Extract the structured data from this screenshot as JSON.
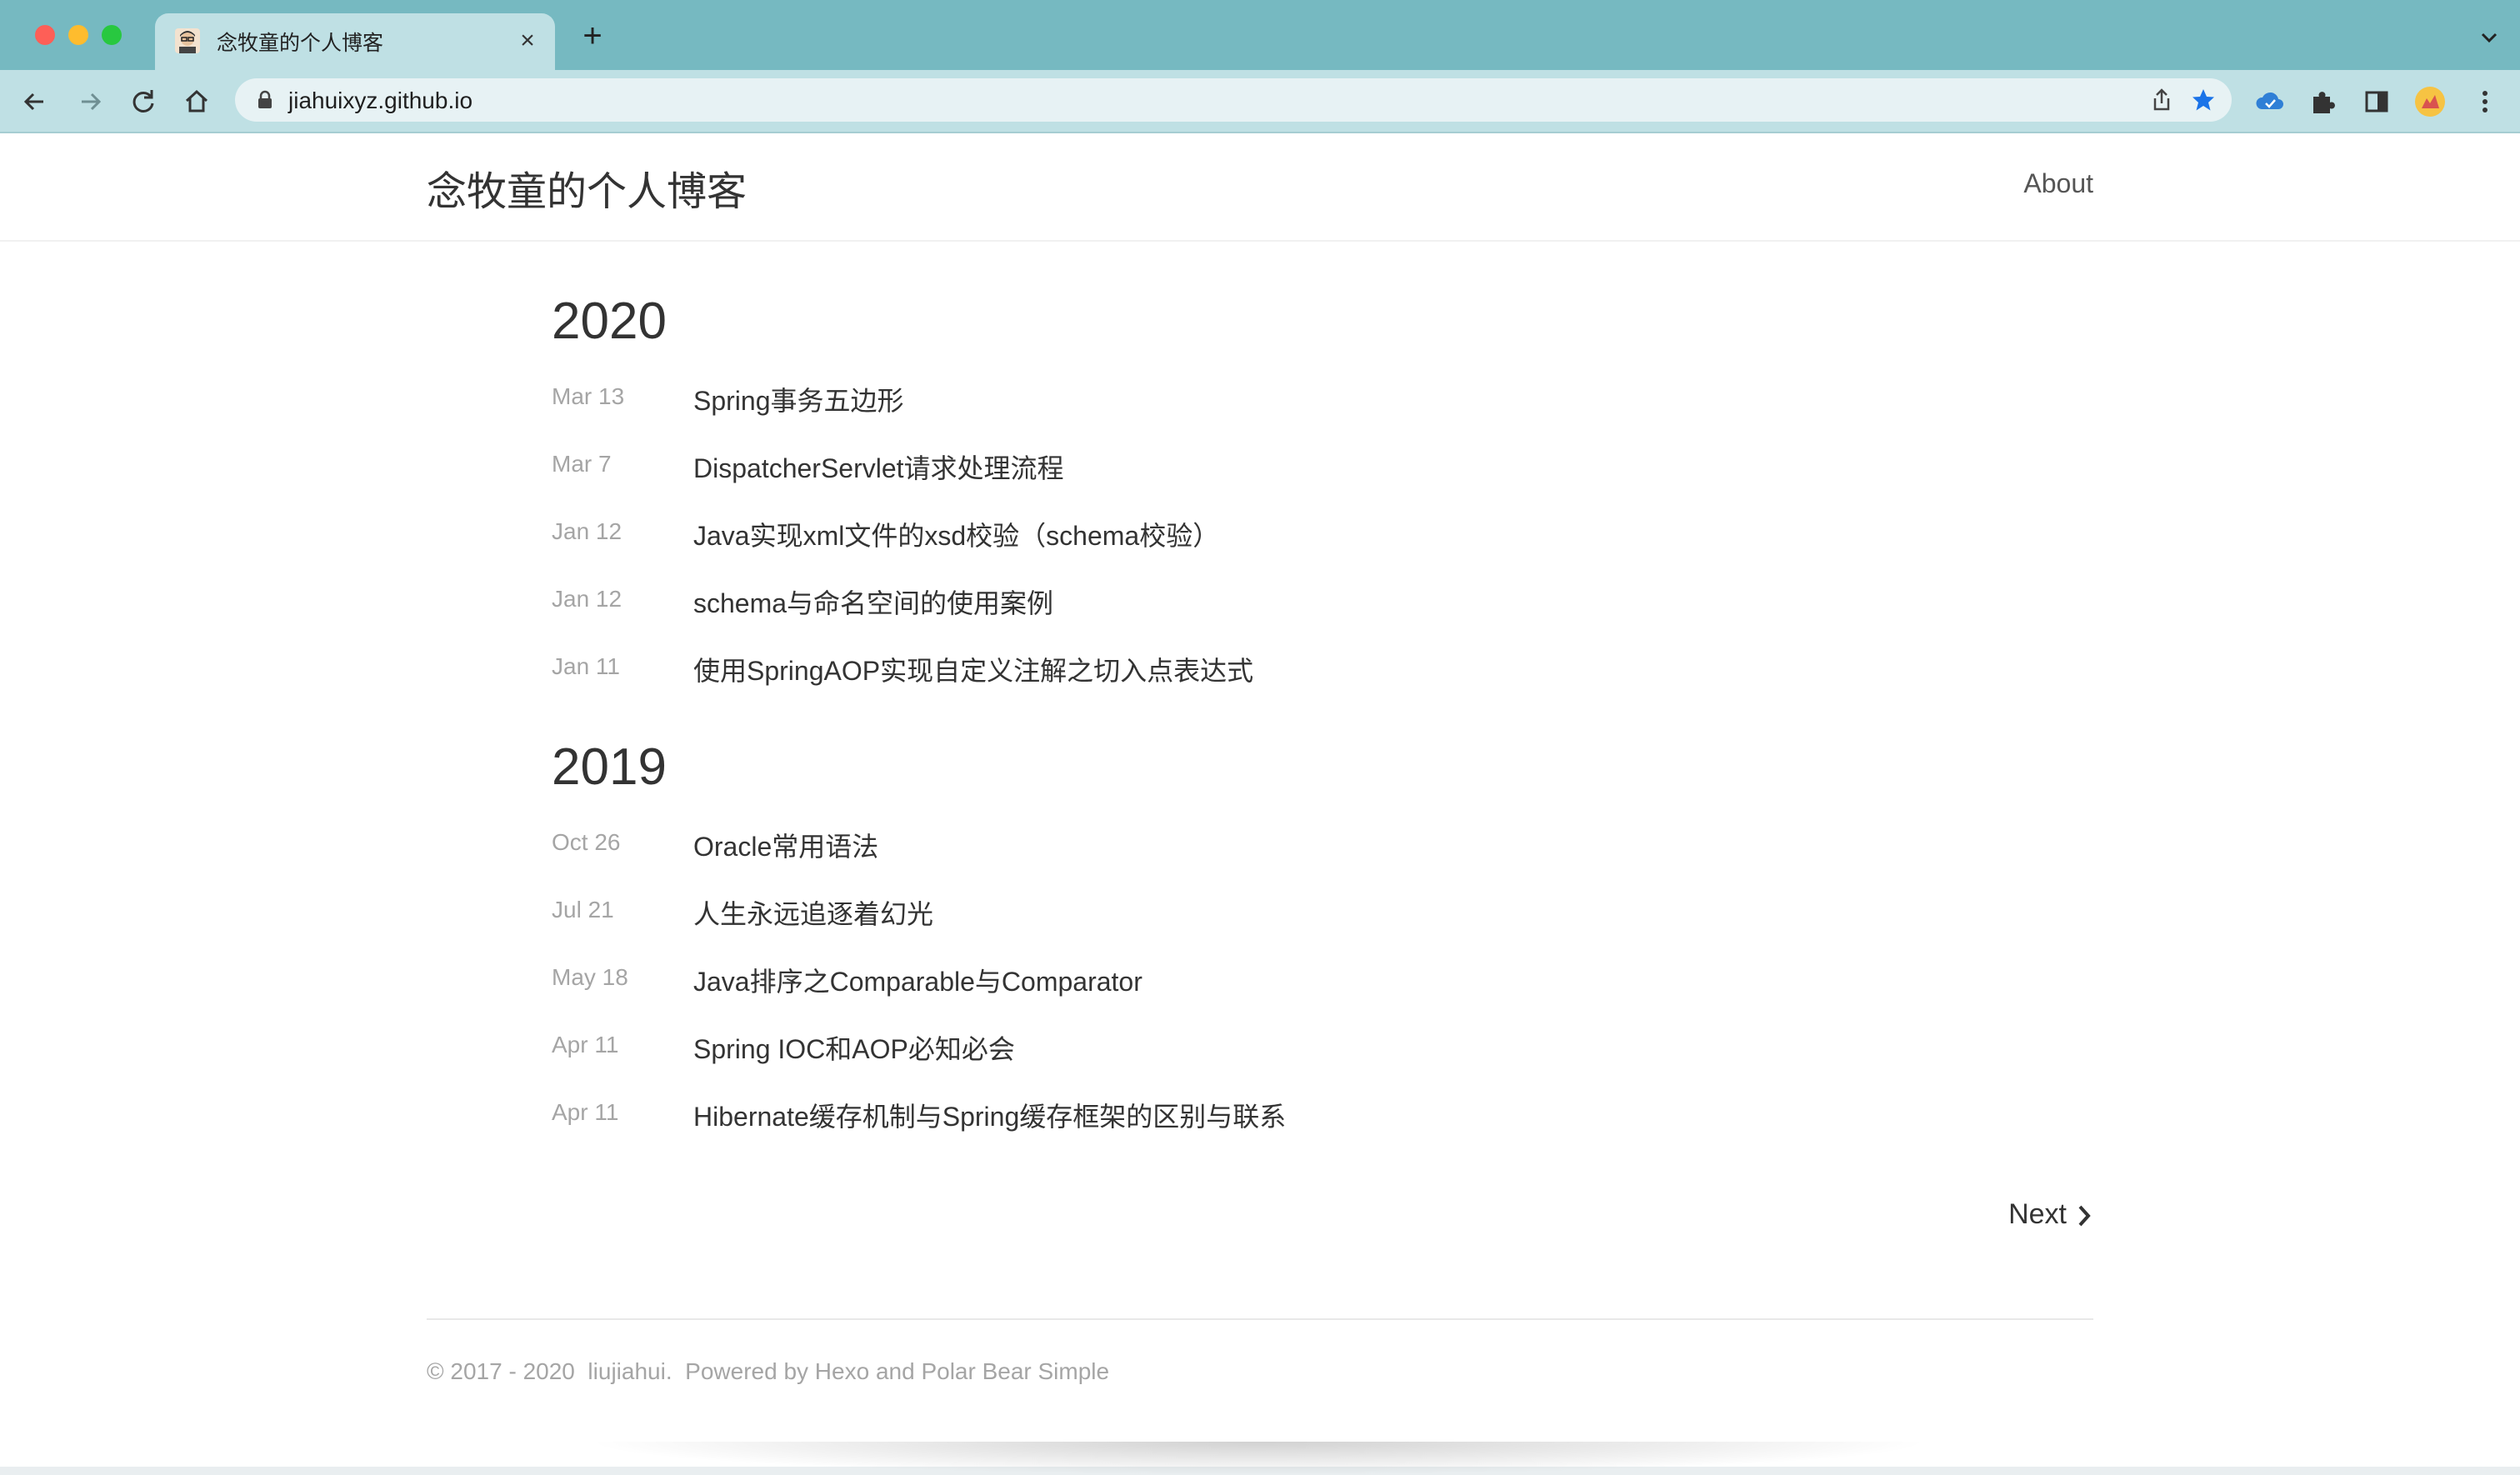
{
  "browser": {
    "tab_title": "念牧童的个人博客",
    "url": "jiahuixyz.github.io",
    "colors": {
      "tabstrip": "#76b9c1",
      "toolbar": "#bfe0e4",
      "bookmark_star": "#1a73e8"
    }
  },
  "site": {
    "title": "念牧童的个人博客",
    "nav": {
      "about": "About"
    }
  },
  "archive": [
    {
      "year": "2020",
      "posts": [
        {
          "date": "Mar 13",
          "title": "Spring事务五边形"
        },
        {
          "date": "Mar 7",
          "title": "DispatcherServlet请求处理流程"
        },
        {
          "date": "Jan 12",
          "title": "Java实现xml文件的xsd校验（schema校验）"
        },
        {
          "date": "Jan 12",
          "title": "schema与命名空间的使用案例"
        },
        {
          "date": "Jan 11",
          "title": "使用SpringAOP实现自定义注解之切入点表达式"
        }
      ]
    },
    {
      "year": "2019",
      "posts": [
        {
          "date": "Oct 26",
          "title": "Oracle常用语法"
        },
        {
          "date": "Jul 21",
          "title": "人生永远追逐着幻光"
        },
        {
          "date": "May 18",
          "title": "Java排序之Comparable与Comparator"
        },
        {
          "date": "Apr 11",
          "title": "Spring IOC和AOP必知必会"
        },
        {
          "date": "Apr 11",
          "title": "Hibernate缓存机制与Spring缓存框架的区别与联系"
        }
      ]
    }
  ],
  "pagination": {
    "next": "Next"
  },
  "footer": {
    "text": "© 2017 - 2020  liujiahui.  Powered by Hexo and Polar Bear Simple"
  }
}
